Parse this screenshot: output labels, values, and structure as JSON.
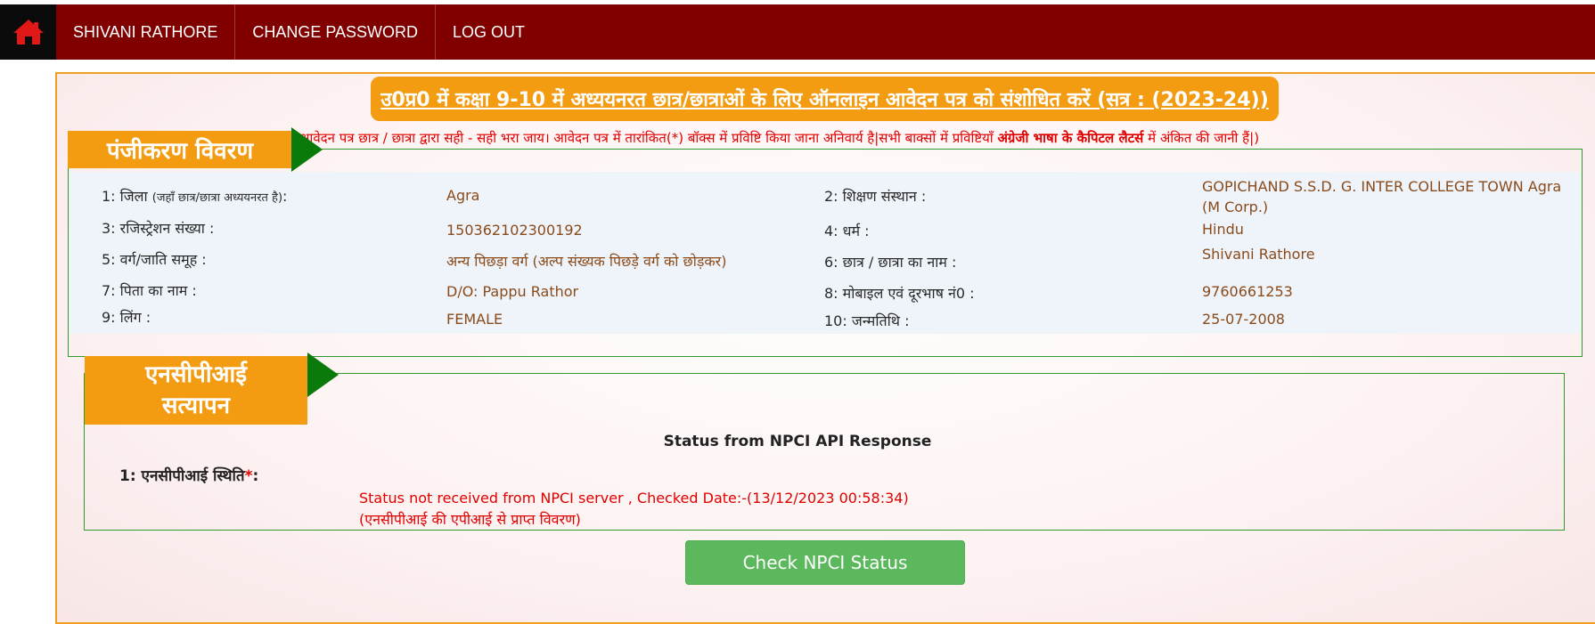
{
  "nav": {
    "home_icon": "home-icon",
    "items": [
      "SHIVANI RATHORE",
      "CHANGE PASSWORD",
      "LOG OUT"
    ]
  },
  "form_title": "उ0प्र0 में कक्षा 9-10 में अध्ययनरत छात्र/छात्राओं के लिए ऑनलाइन आवेदन पत्र को संशोधित करें (सत्र : (2023-24))",
  "notice": {
    "part1": "आवेदन पत्र छात्र / छात्रा द्वारा सही - सही भरा जाय। आवेदन पत्र में तारांकित(*) बॉक्स में प्रविष्टि किया जाना अनिवार्य है|सभी बाक्सों में प्रविष्टियाँ ",
    "bold": "अंग्रेजी भाषा के कैपिटल लैटर्स",
    "part2": " में अंकित की जानी हैं|)"
  },
  "registration": {
    "heading": "पंजीकरण विवरण",
    "fields": [
      {
        "label": "1: जिला",
        "label_small": "(जहाँ छात्र/छात्रा अध्ययनरत है)",
        "label_suffix": ":",
        "value": "Agra"
      },
      {
        "label": "2: शिक्षण संस्थान :",
        "value": "GOPICHAND S.S.D. G. INTER COLLEGE TOWN Agra (M Corp.)"
      },
      {
        "label": "3: रजिस्ट्रेशन संख्या :",
        "value": "150362102300192"
      },
      {
        "label": "4: धर्म :",
        "value": "Hindu"
      },
      {
        "label": "5: वर्ग/जाति समूह :",
        "value": "अन्य पिछड़ा वर्ग (अल्प संख्यक पिछड़े वर्ग को छोड़कर)"
      },
      {
        "label": "6: छात्र / छात्रा का नाम :",
        "value": "Shivani Rathore"
      },
      {
        "label": "7: पिता का नाम :",
        "value": "D/O: Pappu Rathor"
      },
      {
        "label": "8: मोबाइल एवं दूरभाष नं0 :",
        "value": "9760661253"
      },
      {
        "label": "9: लिंग :",
        "value": "FEMALE"
      },
      {
        "label": "10: जन्मतिथि :",
        "value": "25-07-2008"
      }
    ]
  },
  "npci": {
    "heading_line1": "एनसीपीआई",
    "heading_line2": "सत्यापन",
    "response_title": "Status from NPCI API Response",
    "status_label": "1: एनसीपीआई स्थिति",
    "required_mark": "*",
    "label_suffix": ":",
    "status_line1": "Status not received from NPCI server , Checked Date:-(13/12/2023 00:58:34)",
    "status_line2": "(एनसीपीआई की एपीआई से प्राप्त विवरण)",
    "check_button": "Check NPCI Status"
  },
  "colors": {
    "navbar": "#800000",
    "accent_orange": "#f39c12",
    "section_green": "#0a7a0a",
    "button_green": "#5cb85c",
    "error_red": "#e00000"
  }
}
